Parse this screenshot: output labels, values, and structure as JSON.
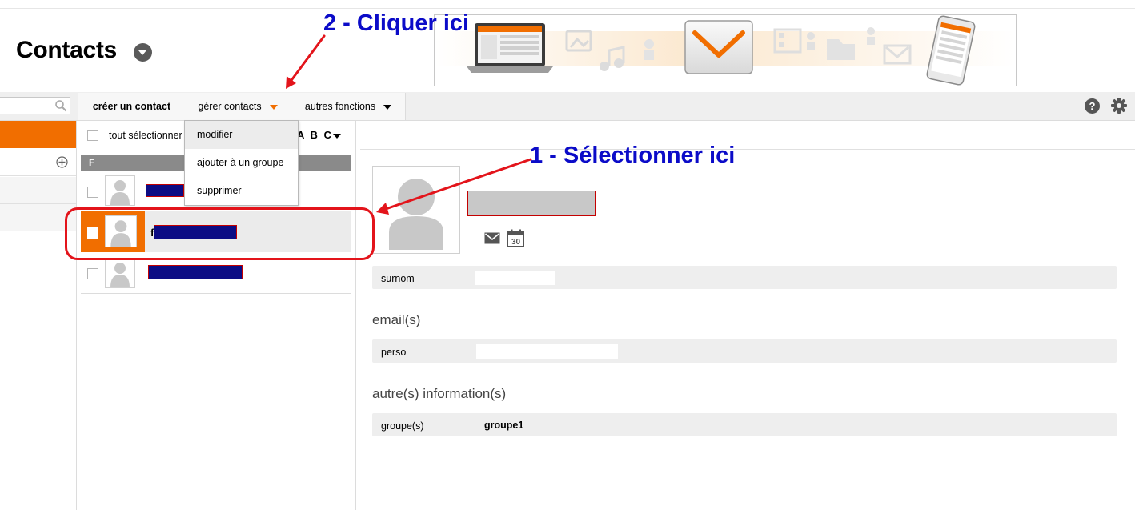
{
  "header": {
    "title": "Contacts"
  },
  "toolbar": {
    "search_placeholder": "",
    "create_contact": "créer un contact",
    "manage_contacts": "gérer contacts",
    "other_functions": "autres fonctions",
    "help_symbol": "?"
  },
  "list": {
    "select_all": "tout sélectionner",
    "sort_label": "A B C",
    "letter_header": "F",
    "selected_row_initial": "f"
  },
  "dropdown": {
    "items": [
      "modifier",
      "ajouter à un groupe",
      "supprimer"
    ]
  },
  "detail": {
    "nickname_label": "surnom",
    "emails_heading": "email(s)",
    "email_label": "perso",
    "other_heading": "autre(s) information(s)",
    "group_label": "groupe(s)",
    "group_value": "groupe1"
  },
  "annotations": {
    "step_2": "2 - Cliquer ici",
    "step_1": "1 - Sélectionner ici"
  },
  "colors": {
    "accent": "#f16e00",
    "annotation_text": "#0b0bc8",
    "annotation_red": "#e3141b",
    "redaction": "#0c0c84"
  },
  "icons": [
    "search-icon",
    "help-icon",
    "gear-icon",
    "add-group-icon",
    "mail-icon",
    "calendar-icon",
    "avatar-icon"
  ]
}
